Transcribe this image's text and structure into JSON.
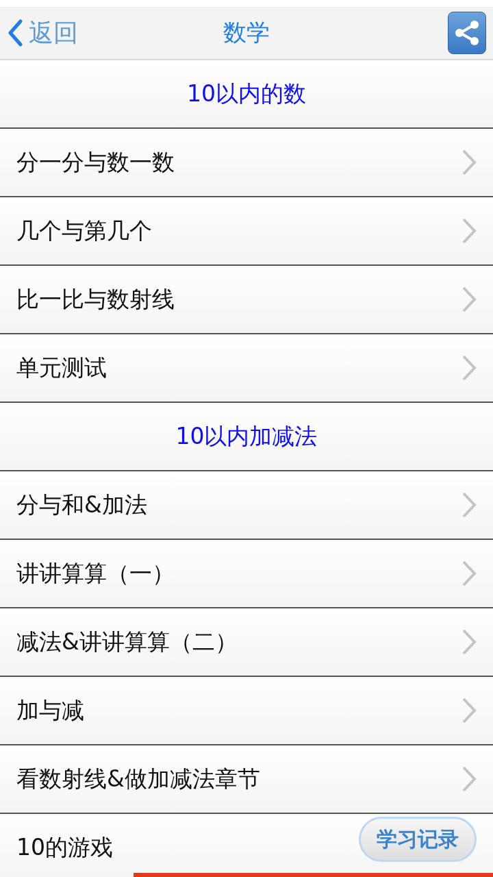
{
  "nav": {
    "back": "返回",
    "title": "数学"
  },
  "sections": [
    {
      "title": "10以内的数",
      "items": [
        {
          "label": "分一分与数一数",
          "kind": "link"
        },
        {
          "label": "几个与第几个",
          "kind": "link"
        },
        {
          "label": "比一比与数射线",
          "kind": "link"
        },
        {
          "label": "单元测试",
          "kind": "link"
        }
      ]
    },
    {
      "title": "10以内加减法",
      "items": [
        {
          "label": "分与和&加法",
          "kind": "link"
        },
        {
          "label": "讲讲算算（一）",
          "kind": "link"
        },
        {
          "label": "减法&讲讲算算（二）",
          "kind": "link"
        },
        {
          "label": "加与减",
          "kind": "link"
        },
        {
          "label": "看数射线&做加减法章节",
          "kind": "link"
        },
        {
          "label": "10的游戏",
          "kind": "plain"
        }
      ]
    }
  ],
  "floating_button": {
    "label": "学习记录"
  }
}
